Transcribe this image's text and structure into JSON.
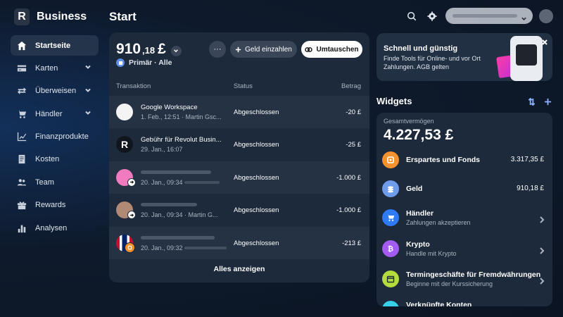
{
  "app": {
    "name": "Business",
    "logo_letter": "R"
  },
  "page": {
    "title": "Start"
  },
  "sidebar": {
    "items": [
      {
        "label": "Startseite",
        "icon": "home-icon",
        "active": true,
        "expandable": false
      },
      {
        "label": "Karten",
        "icon": "card-icon",
        "active": false,
        "expandable": true
      },
      {
        "label": "Überweisen",
        "icon": "transfer-icon",
        "active": false,
        "expandable": true
      },
      {
        "label": "Händler",
        "icon": "cart-icon",
        "active": false,
        "expandable": true
      },
      {
        "label": "Finanzprodukte",
        "icon": "chart-icon",
        "active": false,
        "expandable": false
      },
      {
        "label": "Kosten",
        "icon": "receipt-icon",
        "active": false,
        "expandable": false
      },
      {
        "label": "Team",
        "icon": "team-icon",
        "active": false,
        "expandable": false
      },
      {
        "label": "Rewards",
        "icon": "gift-icon",
        "active": false,
        "expandable": false
      },
      {
        "label": "Analysen",
        "icon": "bar-chart-icon",
        "active": false,
        "expandable": false
      }
    ]
  },
  "account": {
    "balance_int": "910",
    "balance_dec": ",18",
    "currency": "£",
    "label": "Primär · Alle",
    "more_label": "···",
    "deposit_label": "Geld einzahlen",
    "exchange_label": "Umtauschen"
  },
  "transactions": {
    "headers": {
      "transaction": "Transaktion",
      "status": "Status",
      "amount": "Betrag"
    },
    "rows": [
      {
        "name": "Google Workspace",
        "meta": "1. Feb., 12:51 · Martin Gsc...",
        "status": "Abgeschlossen",
        "amount": "-20 £"
      },
      {
        "name": "Gebühr für Revolut Busin...",
        "meta": "29. Jan., 16:07",
        "status": "Abgeschlossen",
        "amount": "-25 £"
      },
      {
        "name": "",
        "meta": "20. Jan., 09:34 ·",
        "status": "Abgeschlossen",
        "amount": "-1.000 £"
      },
      {
        "name": "",
        "meta": "20. Jan., 09:34 · Martin G...",
        "status": "Abgeschlossen",
        "amount": "-1.000 £"
      },
      {
        "name": "",
        "meta": "20. Jan., 09:32 ·",
        "status": "Abgeschlossen",
        "amount": "-213 £"
      }
    ],
    "show_all": "Alles anzeigen"
  },
  "promo": {
    "title": "Schnell und günstig",
    "text": "Finde Tools für Online- und vor Ort Zahlungen. AGB gelten"
  },
  "widgets": {
    "title": "Widgets",
    "total_label": "Gesamtvermögen",
    "total_value": "4.227,53 £",
    "items": [
      {
        "title": "Erspartes und Fonds",
        "sub": "",
        "value": "3.317,35 £",
        "color": "#f5922f",
        "icon": "savings-icon"
      },
      {
        "title": "Geld",
        "sub": "",
        "value": "910,18 £",
        "color": "#6e9bea",
        "icon": "money-icon"
      },
      {
        "title": "Händler",
        "sub": "Zahlungen akzeptieren",
        "value": "",
        "color": "#2f7bf5",
        "icon": "cart-icon"
      },
      {
        "title": "Krypto",
        "sub": "Handle mit Krypto",
        "value": "",
        "color": "#a35bf0",
        "icon": "bitcoin-icon"
      },
      {
        "title": "Termingeschäfte für Fremdwährungen",
        "sub": "Beginne mit der Kurssicherung",
        "value": "",
        "color": "#b5dc3c",
        "icon": "calendar-icon"
      },
      {
        "title": "Verknüpfte Konten",
        "sub": "",
        "value": "",
        "color": "#38d0e8",
        "icon": "link-icon"
      }
    ]
  }
}
